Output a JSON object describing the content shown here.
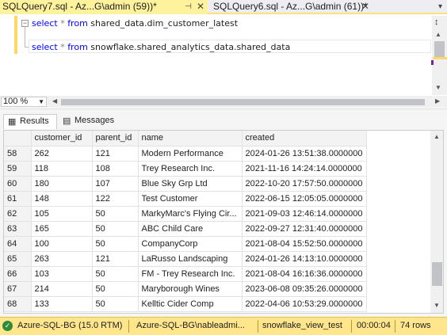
{
  "tabs": [
    {
      "label": "SQLQuery7.sql - Az...G\\admin (59))*",
      "active": true
    },
    {
      "label": "SQLQuery6.sql - Az...G\\admin (61))*",
      "active": false
    }
  ],
  "editor": {
    "line1": {
      "kw": "select",
      "op": "*",
      "kw2": "from",
      "table": "shared_data.dim_customer_latest"
    },
    "line2": {
      "kw": "select",
      "op": "*",
      "kw2": "from",
      "table": "snowflake.shared_analytics_data.shared_data"
    }
  },
  "zoom": {
    "value": "100 %"
  },
  "result_tabs": {
    "results": "Results",
    "messages": "Messages"
  },
  "grid": {
    "columns": [
      "",
      "customer_id",
      "parent_id",
      "name",
      "created"
    ],
    "rows": [
      [
        "58",
        "262",
        "121",
        "Modern Performance",
        "2024-01-26 13:51:38.0000000"
      ],
      [
        "59",
        "118",
        "108",
        "Trey Research Inc.",
        "2021-11-16 14:24:14.0000000"
      ],
      [
        "60",
        "180",
        "107",
        "Blue Sky Grp Ltd",
        "2022-10-20 17:57:50.0000000"
      ],
      [
        "61",
        "148",
        "122",
        "Test Customer",
        "2022-06-15 12:05:05.0000000"
      ],
      [
        "62",
        "105",
        "50",
        "MarkyMarc's Flying Cir...",
        "2021-09-03 12:46:14.0000000"
      ],
      [
        "63",
        "165",
        "50",
        "ABC Child Care",
        "2022-09-27 12:31:40.0000000"
      ],
      [
        "64",
        "100",
        "50",
        "CompanyCorp",
        "2021-08-04 15:52:50.0000000"
      ],
      [
        "65",
        "263",
        "121",
        "LaRusso Landscaping",
        "2024-01-26 14:13:10.0000000"
      ],
      [
        "66",
        "103",
        "50",
        "FM - Trey Research Inc.",
        "2021-08-04 16:16:36.0000000"
      ],
      [
        "67",
        "214",
        "50",
        "Maryborough Wines",
        "2023-06-08 09:35:26.0000000"
      ],
      [
        "68",
        "133",
        "50",
        "Kelltic Cider Comp",
        "2022-04-06 10:53:29.0000000"
      ]
    ]
  },
  "status": {
    "server": "Azure-SQL-BG (15.0 RTM)",
    "login": "Azure-SQL-BG\\nableadmi...",
    "database": "snowflake_view_test",
    "elapsed": "00:00:04",
    "rows": "74 rows"
  },
  "colors": {
    "accent": "#ffe68d",
    "active_tab": "#fff29d",
    "keyword": "#0000ff"
  }
}
